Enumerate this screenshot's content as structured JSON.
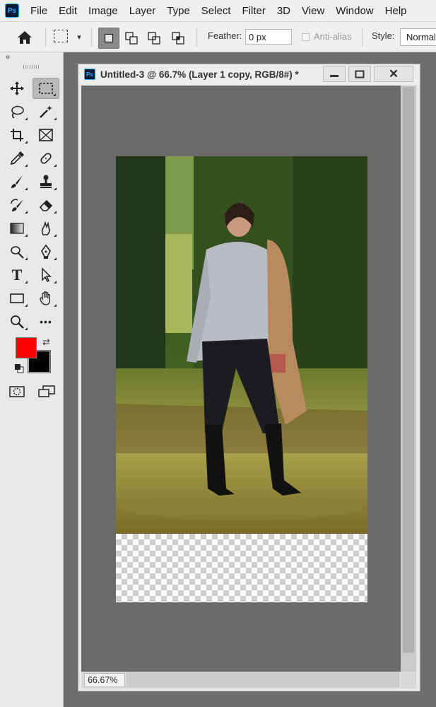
{
  "app": {
    "logo_text": "Ps"
  },
  "menu": {
    "items": [
      "File",
      "Edit",
      "Image",
      "Layer",
      "Type",
      "Select",
      "Filter",
      "3D",
      "View",
      "Window",
      "Help"
    ]
  },
  "options_bar": {
    "feather_label": "Feather:",
    "feather_value": "0 px",
    "anti_alias_label": "Anti-alias",
    "anti_alias_checked": false,
    "style_label": "Style:",
    "style_value": "Normal"
  },
  "toolbar": {
    "collapse_glyph": "«",
    "active_tool": "rectangular-marquee-tool",
    "tools": [
      "move-tool",
      "rectangular-marquee-tool",
      "lasso-tool",
      "magic-wand-tool",
      "crop-tool",
      "frame-tool",
      "eyedropper-tool",
      "spot-healing-brush-tool",
      "brush-tool",
      "clone-stamp-tool",
      "history-brush-tool",
      "eraser-tool",
      "gradient-tool",
      "smudge-tool",
      "dodge-tool",
      "pen-tool",
      "type-tool",
      "path-selection-tool",
      "rectangle-tool",
      "hand-tool",
      "zoom-tool",
      "edit-toolbar"
    ],
    "type_tool_glyph": "T",
    "more_glyph": "•••",
    "foreground_color": "#ff0000",
    "background_color": "#000000",
    "swap_glyph": "⇄"
  },
  "document": {
    "title": "Untitled-3 @ 66.7% (Layer 1 copy, RGB/8#) *",
    "icon_text": "Ps",
    "close_glyph": "✕",
    "zoom": "66.67%"
  }
}
